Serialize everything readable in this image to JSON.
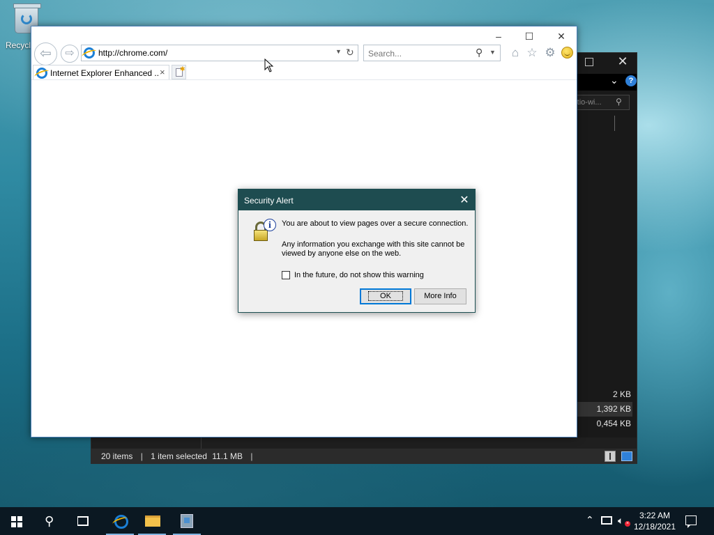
{
  "desktop": {
    "recycle_bin_label": "Recycl"
  },
  "explorer": {
    "search_text": "rtio-wi...",
    "file_sizes": [
      "2 KB",
      "1,392 KB",
      "0,454 KB"
    ],
    "status_items": "20 items",
    "status_selected": "1 item selected",
    "status_size": "11.1 MB",
    "separator": "|"
  },
  "ie": {
    "address_value": "http://chrome.com/",
    "search_placeholder": "Search...",
    "tab_title": "Internet Explorer Enhanced ...",
    "tab_close": "×",
    "window_minimize": "–",
    "window_maximize": "☐",
    "window_close": "✕"
  },
  "dialog": {
    "title": "Security Alert",
    "close": "✕",
    "message_primary": "You are about to view pages over a secure connection.",
    "message_secondary": "Any information you exchange with this site cannot be viewed by anyone else on the web.",
    "checkbox_label": "In the future, do not show this warning",
    "checkbox_checked": false,
    "ok_label": "OK",
    "more_info_label": "More Info"
  },
  "taskbar": {
    "time": "3:22 AM",
    "date": "12/18/2021"
  },
  "colors": {
    "dialog_title_bg": "#1e4c50",
    "explorer_bg": "#191919",
    "taskbar_bg": "#0b1822"
  }
}
